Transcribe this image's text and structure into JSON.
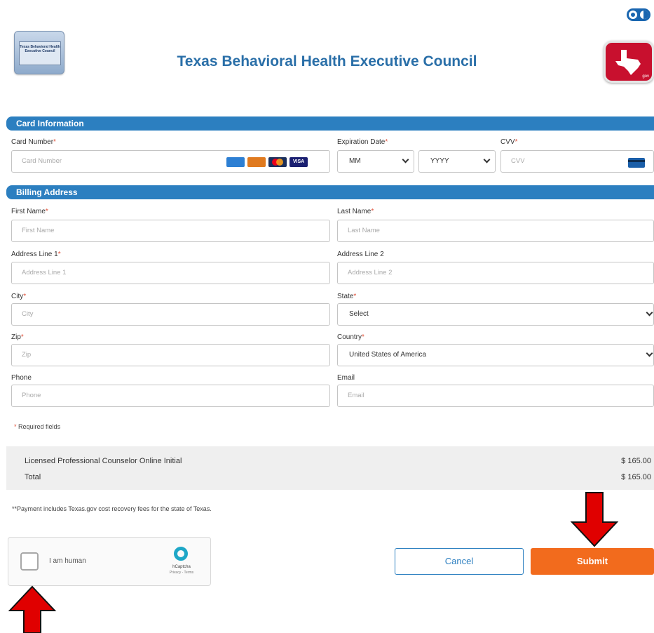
{
  "header": {
    "council_logo_text": "Texas Behavioral Health Executive Council",
    "title": "Texas Behavioral Health Executive Council",
    "texas_logo_text": "gov"
  },
  "card_section": {
    "heading": "Card Information",
    "card_number_label": "Card Number",
    "card_number_placeholder": "Card Number",
    "expiration_label": "Expiration Date",
    "month_value": "MM",
    "year_value": "YYYY",
    "cvv_label": "CVV",
    "cvv_placeholder": "CVV",
    "card_brands": [
      "AMERICAN EXPRESS",
      "DISCOVER",
      "mastercard",
      "VISA"
    ]
  },
  "billing_section": {
    "heading": "Billing Address",
    "first_name_label": "First Name",
    "first_name_placeholder": "First Name",
    "last_name_label": "Last Name",
    "last_name_placeholder": "Last Name",
    "address1_label": "Address Line 1",
    "address1_placeholder": "Address Line 1",
    "address2_label": "Address Line 2",
    "address2_placeholder": "Address Line 2",
    "city_label": "City",
    "city_placeholder": "City",
    "state_label": "State",
    "state_value": "Select",
    "zip_label": "Zip",
    "zip_placeholder": "Zip",
    "country_label": "Country",
    "country_value": "United States of America",
    "phone_label": "Phone",
    "phone_placeholder": "Phone",
    "email_label": "Email",
    "email_placeholder": "Email"
  },
  "required_mark": "*",
  "required_note": "Required fields",
  "summary": {
    "item_label": "Licensed Professional Counselor Online Initial",
    "item_amount": "$ 165.00",
    "total_label": "Total",
    "total_amount": "$ 165.00"
  },
  "fee_note": "**Payment includes Texas.gov cost recovery fees for the state of Texas.",
  "captcha": {
    "label": "I am human",
    "brand": "hCaptcha",
    "links": "Privacy - Terms"
  },
  "buttons": {
    "cancel": "Cancel",
    "submit": "Submit"
  },
  "colors": {
    "brand_blue": "#2c7fc0",
    "submit_orange": "#f26b1d",
    "required_red": "#e0523b",
    "annotation_red": "#e00000"
  }
}
